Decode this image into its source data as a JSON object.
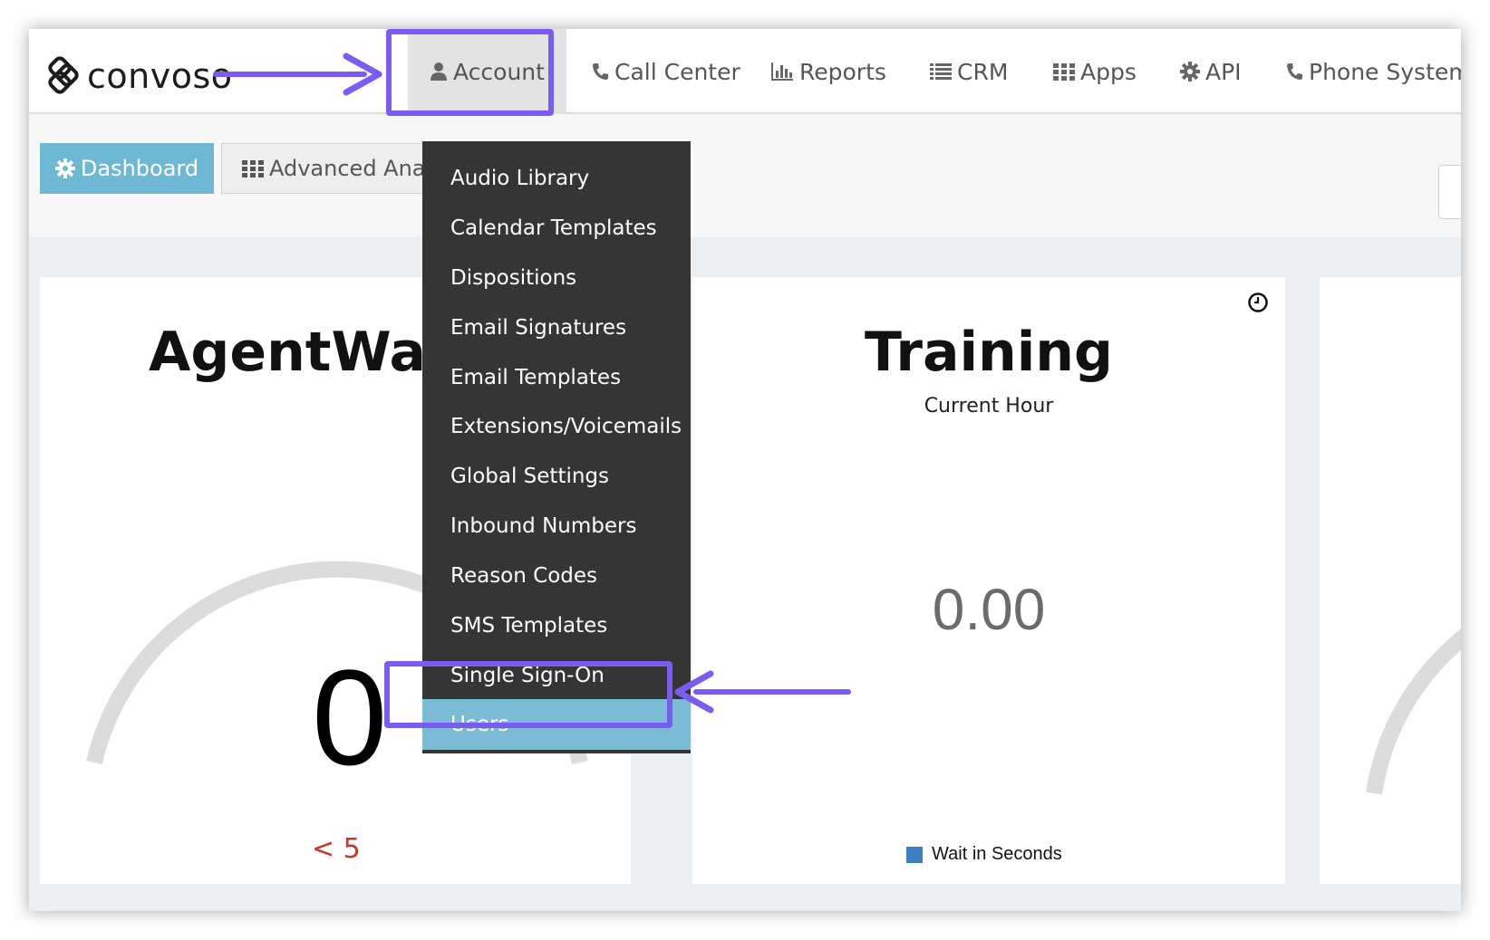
{
  "app": {
    "logo_text": "convoso"
  },
  "nav": {
    "items": [
      {
        "label": "Account",
        "icon": "user-icon"
      },
      {
        "label": "Call Center",
        "icon": "phone-icon"
      },
      {
        "label": "Reports",
        "icon": "bar-chart-icon"
      },
      {
        "label": "CRM",
        "icon": "list-icon"
      },
      {
        "label": "Apps",
        "icon": "grid-icon"
      },
      {
        "label": "API",
        "icon": "gear-icon"
      },
      {
        "label": "Phone System",
        "icon": "phone-icon"
      }
    ]
  },
  "subnav": {
    "dashboard_label": "Dashboard",
    "advanced_label": "Advanced Anal"
  },
  "account_menu": {
    "items": [
      "Audio Library",
      "Calendar Templates",
      "Dispositions",
      "Email Signatures",
      "Email Templates",
      "Extensions/Voicemails",
      "Global Settings",
      "Inbound Numbers",
      "Reason Codes",
      "SMS Templates",
      "Single Sign-On",
      "Users"
    ],
    "active": "Users"
  },
  "cards": {
    "left": {
      "title": "AgentWaiti",
      "value": "0",
      "threshold": "< 5"
    },
    "mid": {
      "title": "Training",
      "subtitle": "Current Hour",
      "value": "0.00",
      "legend": "Wait in Seconds"
    }
  },
  "colors": {
    "highlight": "#7a5cf0",
    "accent": "#6fb8d4",
    "menu_bg": "#353535",
    "menu_active": "#7bbbd6",
    "threshold": "#c0392b",
    "legend": "#3d7dc0"
  }
}
